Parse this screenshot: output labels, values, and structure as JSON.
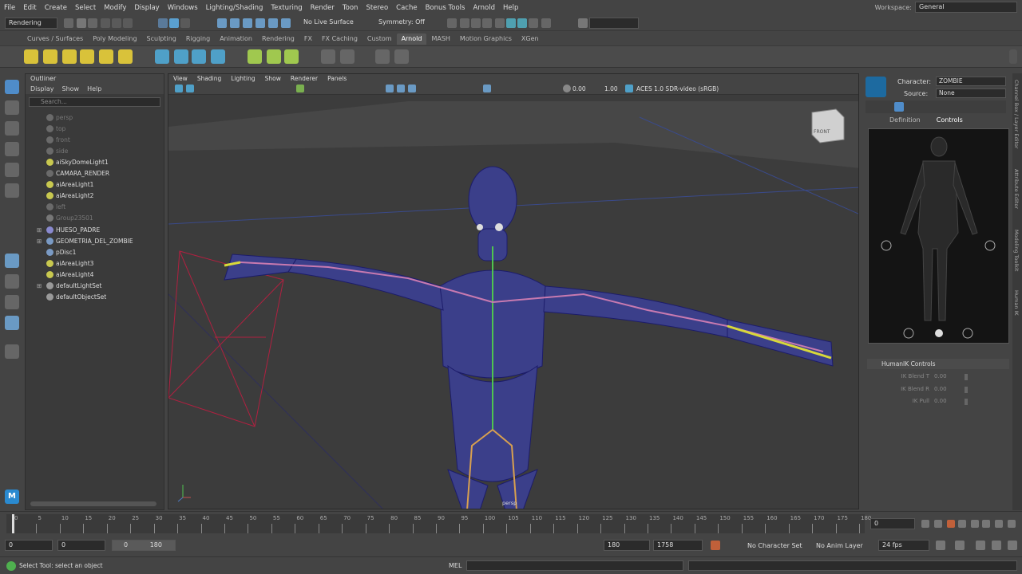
{
  "menubar": {
    "items": [
      "File",
      "Edit",
      "Create",
      "Select",
      "Modify",
      "Display",
      "Windows",
      "Lighting/Shading",
      "Texturing",
      "Render",
      "Toon",
      "Stereo",
      "Cache",
      "Bonus Tools",
      "Arnold",
      "Help"
    ],
    "workspace_label": "Workspace:",
    "workspace_value": "General"
  },
  "statusline": {
    "mode": "Rendering",
    "live_surface": "No Live Surface",
    "symmetry": "Symmetry: Off"
  },
  "shelf": {
    "tabs": [
      "Curves / Surfaces",
      "Poly Modeling",
      "Sculpting",
      "Rigging",
      "Animation",
      "Rendering",
      "FX",
      "FX Caching",
      "Custom",
      "Arnold",
      "MASH",
      "Motion Graphics",
      "XGen"
    ],
    "active_tab": "Arnold"
  },
  "outliner": {
    "title": "Outliner",
    "menu": [
      "Display",
      "Show",
      "Help"
    ],
    "search_placeholder": "Search...",
    "items": [
      {
        "label": "persp",
        "dim": true,
        "icon": "camera-icon"
      },
      {
        "label": "top",
        "dim": true,
        "icon": "camera-icon"
      },
      {
        "label": "front",
        "dim": true,
        "icon": "camera-icon"
      },
      {
        "label": "side",
        "dim": true,
        "icon": "camera-icon"
      },
      {
        "label": "aiSkyDomeLight1",
        "dim": false,
        "icon": "light-icon"
      },
      {
        "label": "CAMARA_RENDER",
        "dim": false,
        "icon": "camera-icon"
      },
      {
        "label": "aiAreaLight1",
        "dim": false,
        "icon": "light-icon"
      },
      {
        "label": "aiAreaLight2",
        "dim": false,
        "icon": "light-icon"
      },
      {
        "label": "left",
        "dim": true,
        "icon": "camera-icon"
      },
      {
        "label": "Group23501",
        "dim": true,
        "icon": "group-icon"
      },
      {
        "label": "HUESO_PADRE",
        "dim": false,
        "icon": "joint-icon",
        "expand": true
      },
      {
        "label": "GEOMETRIA_DEL_ZOMBIE",
        "dim": false,
        "icon": "mesh-icon",
        "expand": true
      },
      {
        "label": "pDisc1",
        "dim": false,
        "icon": "mesh-icon"
      },
      {
        "label": "aiAreaLight3",
        "dim": false,
        "icon": "light-icon"
      },
      {
        "label": "aiAreaLight4",
        "dim": false,
        "icon": "light-icon"
      },
      {
        "label": "defaultLightSet",
        "dim": false,
        "icon": "set-icon",
        "expand": true
      },
      {
        "label": "defaultObjectSet",
        "dim": false,
        "icon": "set-icon"
      }
    ]
  },
  "viewport": {
    "menu": [
      "View",
      "Shading",
      "Lighting",
      "Show",
      "Renderer",
      "Panels"
    ],
    "exposure": "0.00",
    "gamma": "1.00",
    "color_space": "ACES 1.0 SDR-video (sRGB)",
    "camera_label": "persp",
    "viewcube_label": "FRONT"
  },
  "humanik": {
    "character_label": "Character:",
    "character_value": "ZOMBIE",
    "source_label": "Source:",
    "source_value": "None",
    "tabs": [
      "Definition",
      "Controls"
    ],
    "active_tab": "Controls",
    "section_title": "HumanIK Controls",
    "sliders": [
      {
        "label": "IK Blend T",
        "value": "0.00"
      },
      {
        "label": "IK Blend R",
        "value": "0.00"
      },
      {
        "label": "IK Pull",
        "value": "0.00"
      }
    ]
  },
  "side_tabs": [
    "Channel Box / Layer Editor",
    "Attribute Editor",
    "Modeling Toolkit",
    "Human IK"
  ],
  "timeline": {
    "ticks": [
      "0",
      "5",
      "10",
      "15",
      "20",
      "25",
      "30",
      "35",
      "40",
      "45",
      "50",
      "55",
      "60",
      "65",
      "70",
      "75",
      "80",
      "85",
      "90",
      "95",
      "100",
      "105",
      "110",
      "115",
      "120",
      "125",
      "130",
      "135",
      "140",
      "145",
      "150",
      "155",
      "160",
      "165",
      "170",
      "175",
      "180"
    ],
    "current_frame": "0"
  },
  "range": {
    "start": "0",
    "anim_start": "0",
    "slider_start": "0",
    "slider_end": "180",
    "anim_end": "180",
    "end": "1758",
    "character_set": "No Character Set",
    "anim_layer": "No Anim Layer",
    "fps": "24 fps"
  },
  "commandline": {
    "help_text": "Select Tool: select an object",
    "lang": "MEL"
  }
}
